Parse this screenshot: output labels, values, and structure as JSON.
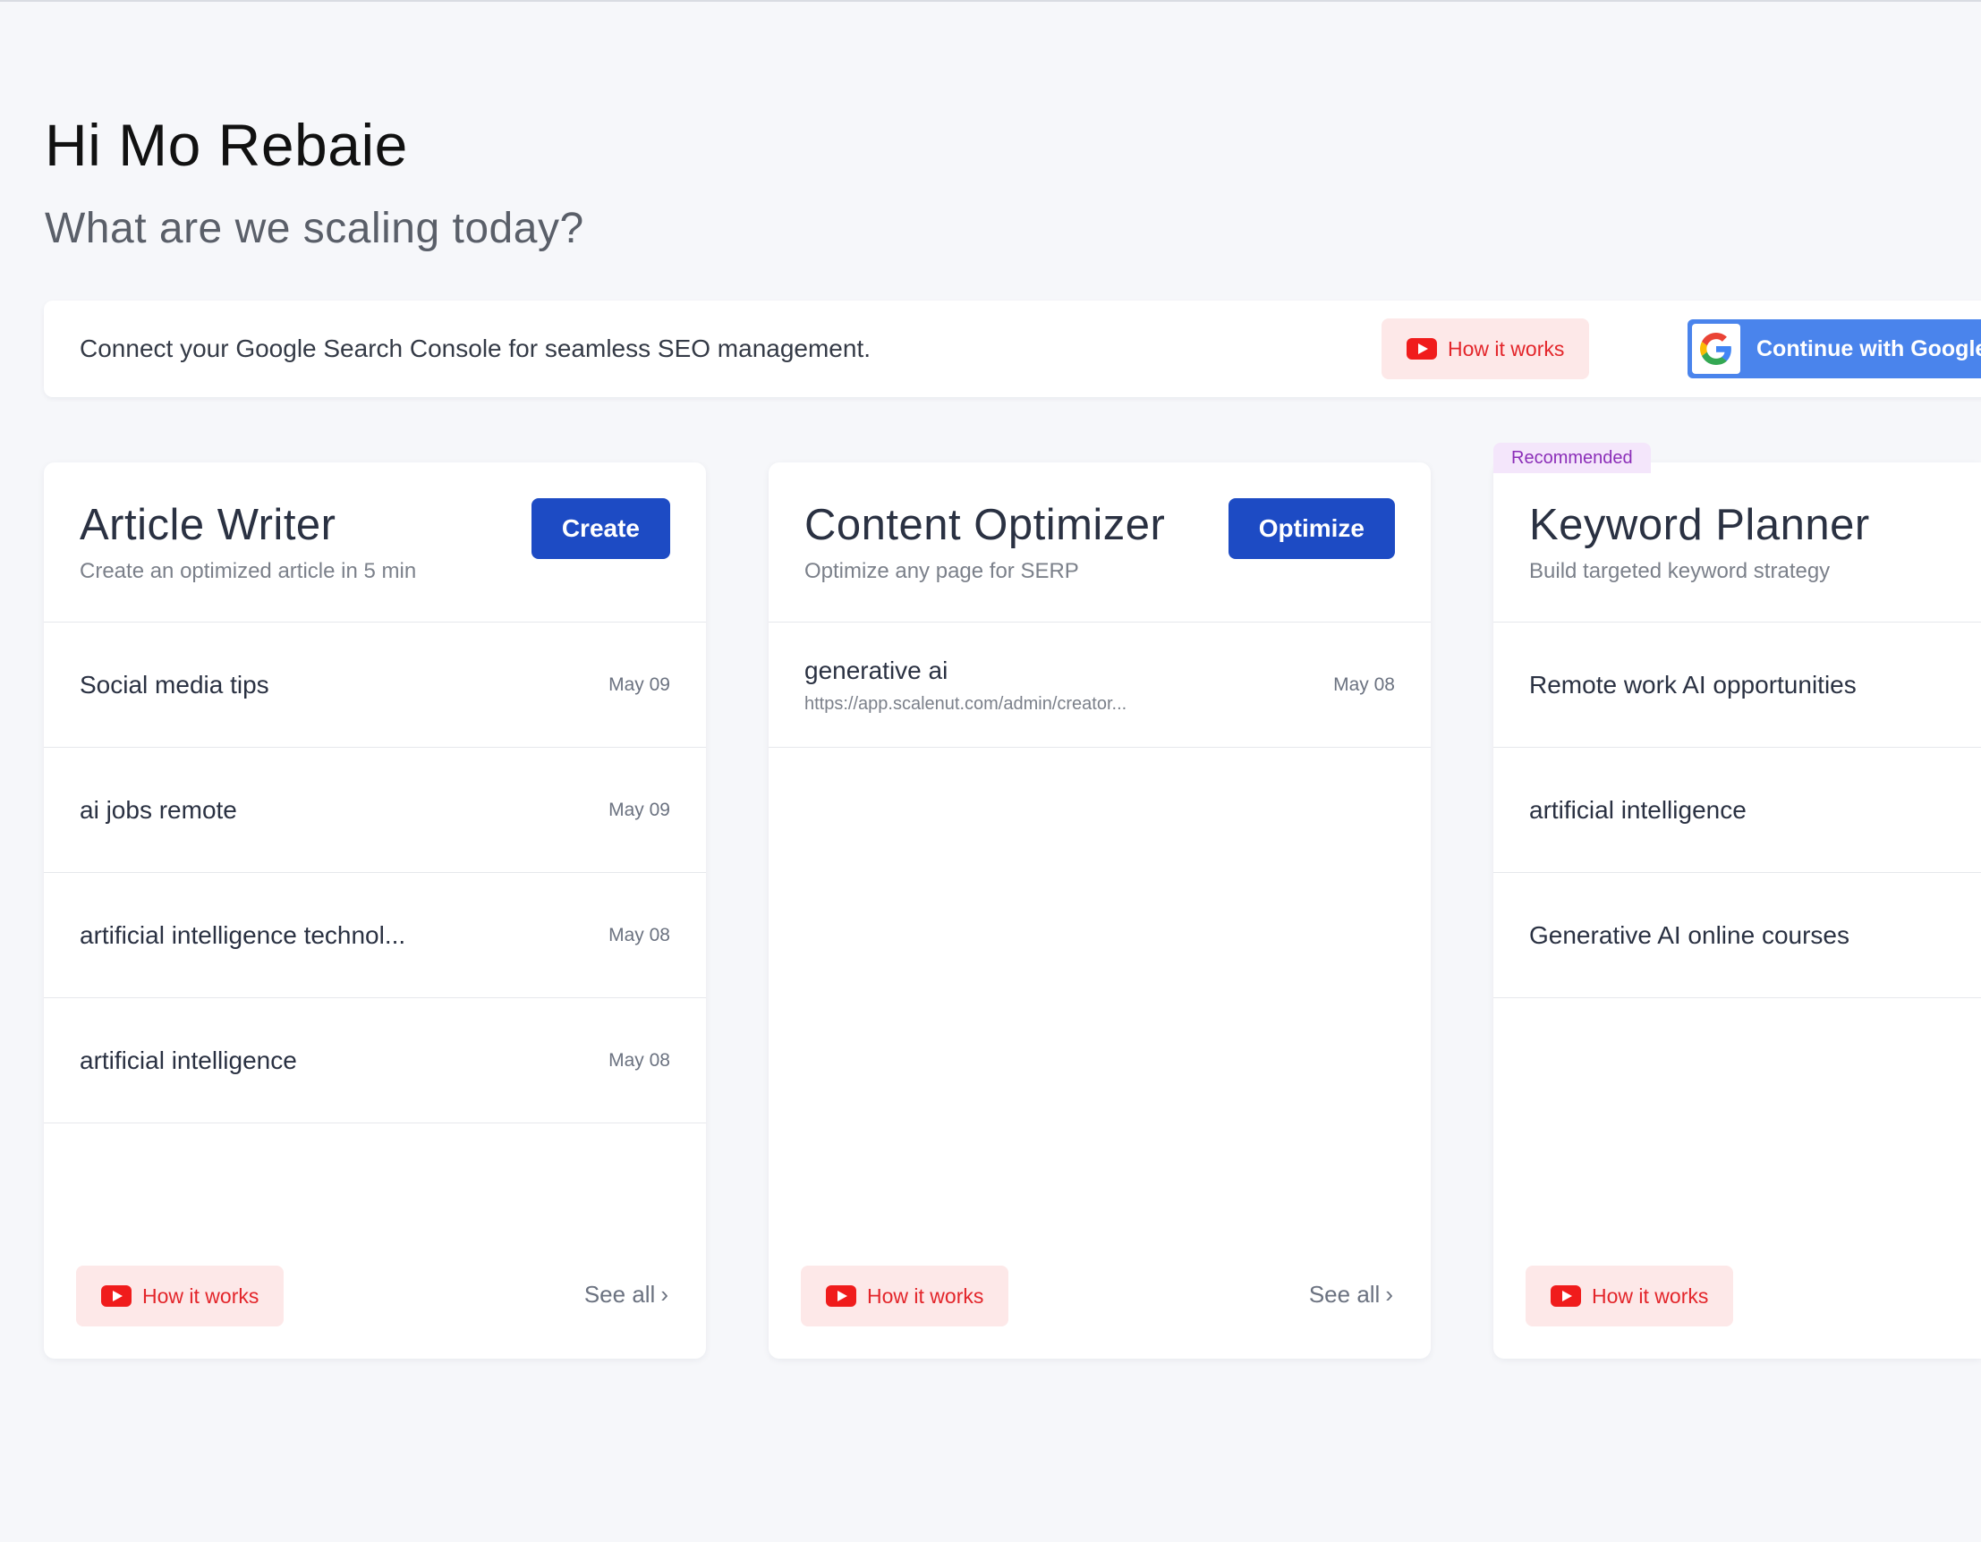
{
  "greeting": "Hi Mo Rebaie",
  "subtitle": "What are we scaling today?",
  "banner": {
    "text": "Connect your Google Search Console for seamless SEO management.",
    "how_label": "How it works",
    "google_label": "Continue with Google"
  },
  "cards": [
    {
      "title": "Article Writer",
      "desc": "Create an optimized article in 5 min",
      "action": "Create",
      "rows": [
        {
          "title": "Social media tips",
          "date": "May 09"
        },
        {
          "title": "ai jobs remote",
          "date": "May 09"
        },
        {
          "title": "artificial intelligence technol...",
          "date": "May 08"
        },
        {
          "title": "artificial intelligence",
          "date": "May 08"
        }
      ],
      "how_label": "How it works",
      "see_all": "See all"
    },
    {
      "title": "Content Optimizer",
      "desc": "Optimize any page for SERP",
      "action": "Optimize",
      "rows": [
        {
          "title": "generative ai",
          "url": "https://app.scalenut.com/admin/creator...",
          "date": "May 08"
        }
      ],
      "how_label": "How it works",
      "see_all": "See all"
    },
    {
      "tag": "Recommended",
      "title": "Keyword Planner",
      "desc": "Build targeted keyword strategy",
      "rows": [
        {
          "title": "Remote work AI opportunities"
        },
        {
          "title": "artificial intelligence"
        },
        {
          "title": "Generative AI online courses"
        }
      ],
      "how_label": "How it works"
    }
  ],
  "colors": {
    "primary": "#1d4bc4",
    "google_blue": "#4a84ec",
    "youtube_red": "#f01c1c",
    "recommended_bg": "#f4e6fb",
    "recommended_text": "#8b2eb8"
  },
  "icons": {
    "youtube": "youtube-icon",
    "google": "google-icon",
    "chevron": "chevron-right-icon"
  }
}
